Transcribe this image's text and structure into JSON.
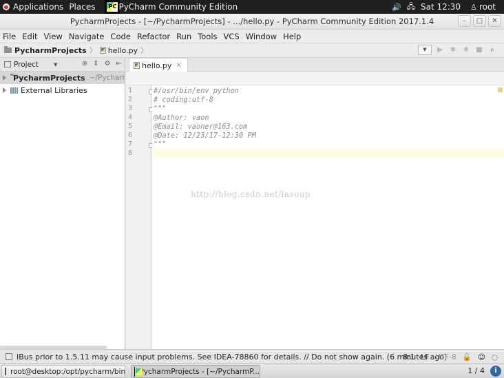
{
  "topbar": {
    "applications": "Applications",
    "places": "Places",
    "app_label": "PyCharm Community Edition",
    "clock": "Sat 12:30",
    "user": "root",
    "icons": [
      "volume-icon",
      "network-icon",
      "user-icon"
    ]
  },
  "window": {
    "title": "PycharmProjects - [~/PycharmProjects] - .../hello.py - PyCharm Community Edition 2017.1.4",
    "buttons": [
      "–",
      "□",
      "✕"
    ]
  },
  "menu": [
    "File",
    "Edit",
    "View",
    "Navigate",
    "Code",
    "Refactor",
    "Run",
    "Tools",
    "VCS",
    "Window",
    "Help"
  ],
  "navbar": {
    "project": "PycharmProjects",
    "file": "hello.py"
  },
  "project_panel": {
    "title": "Project",
    "tree": [
      {
        "label": "PycharmProjects",
        "path": "~/PycharmPr"
      },
      {
        "label": "External Libraries"
      }
    ]
  },
  "editor": {
    "tab": "hello.py",
    "line_numbers": [
      "1",
      "2",
      "3",
      "4",
      "5",
      "6",
      "7",
      "8"
    ],
    "lines": [
      "#/usr/bin/env python",
      "# coding:utf-8",
      "\"\"\"",
      "@Author: vaon",
      "@Email: vaoner@163.com",
      "@Date: 12/23/17-12:30 PM",
      "\"\"\"",
      ""
    ],
    "watermark": "http://blog.csdn.net/lasoup"
  },
  "status": {
    "message": "IBus prior to 1.5.11 may cause input problems. See IDEA-78860 for details. // Do not show again. (6 minutes ago)",
    "position": "8:1",
    "line_sep": "LF",
    "encoding": "UTF-8"
  },
  "taskbar": {
    "terminal": "root@desktop:/opt/pycharm/bin",
    "pycharm": "PycharmProjects - [~/PycharmP...",
    "pager": "1 / 4"
  }
}
